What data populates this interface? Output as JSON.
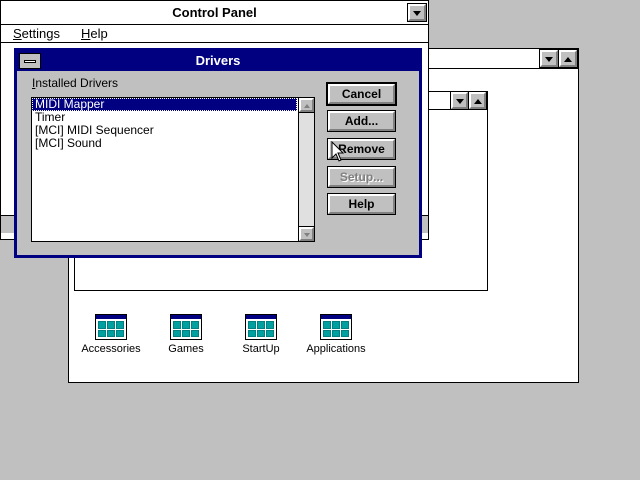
{
  "control_panel": {
    "title": "Control Panel",
    "menu": [
      {
        "label": "Settings",
        "accel": "S",
        "rest": "ettings"
      },
      {
        "label": "Help",
        "accel": "H",
        "rest": "elp"
      }
    ]
  },
  "program_manager": {
    "groups": [
      {
        "label": "Accessories",
        "icon": "program-group-icon"
      },
      {
        "label": "Games",
        "icon": "program-group-icon"
      },
      {
        "label": "StartUp",
        "icon": "program-group-icon"
      },
      {
        "label": "Applications",
        "icon": "program-group-icon"
      }
    ]
  },
  "dialog": {
    "title": "Drivers",
    "list_label": "Installed Drivers",
    "list_label_accel": "I",
    "list_label_rest": "nstalled Drivers",
    "drivers": [
      "MIDI Mapper",
      "Timer",
      "[MCI] MIDI Sequencer",
      "[MCI] Sound"
    ],
    "selected_index": 0,
    "buttons": {
      "cancel": "Cancel",
      "add": "Add...",
      "remove": "Remove",
      "setup": "Setup...",
      "help": "Help"
    }
  },
  "colors": {
    "desktop": "#c0c0c0",
    "active_title": "#000080",
    "selection": "#000080"
  }
}
